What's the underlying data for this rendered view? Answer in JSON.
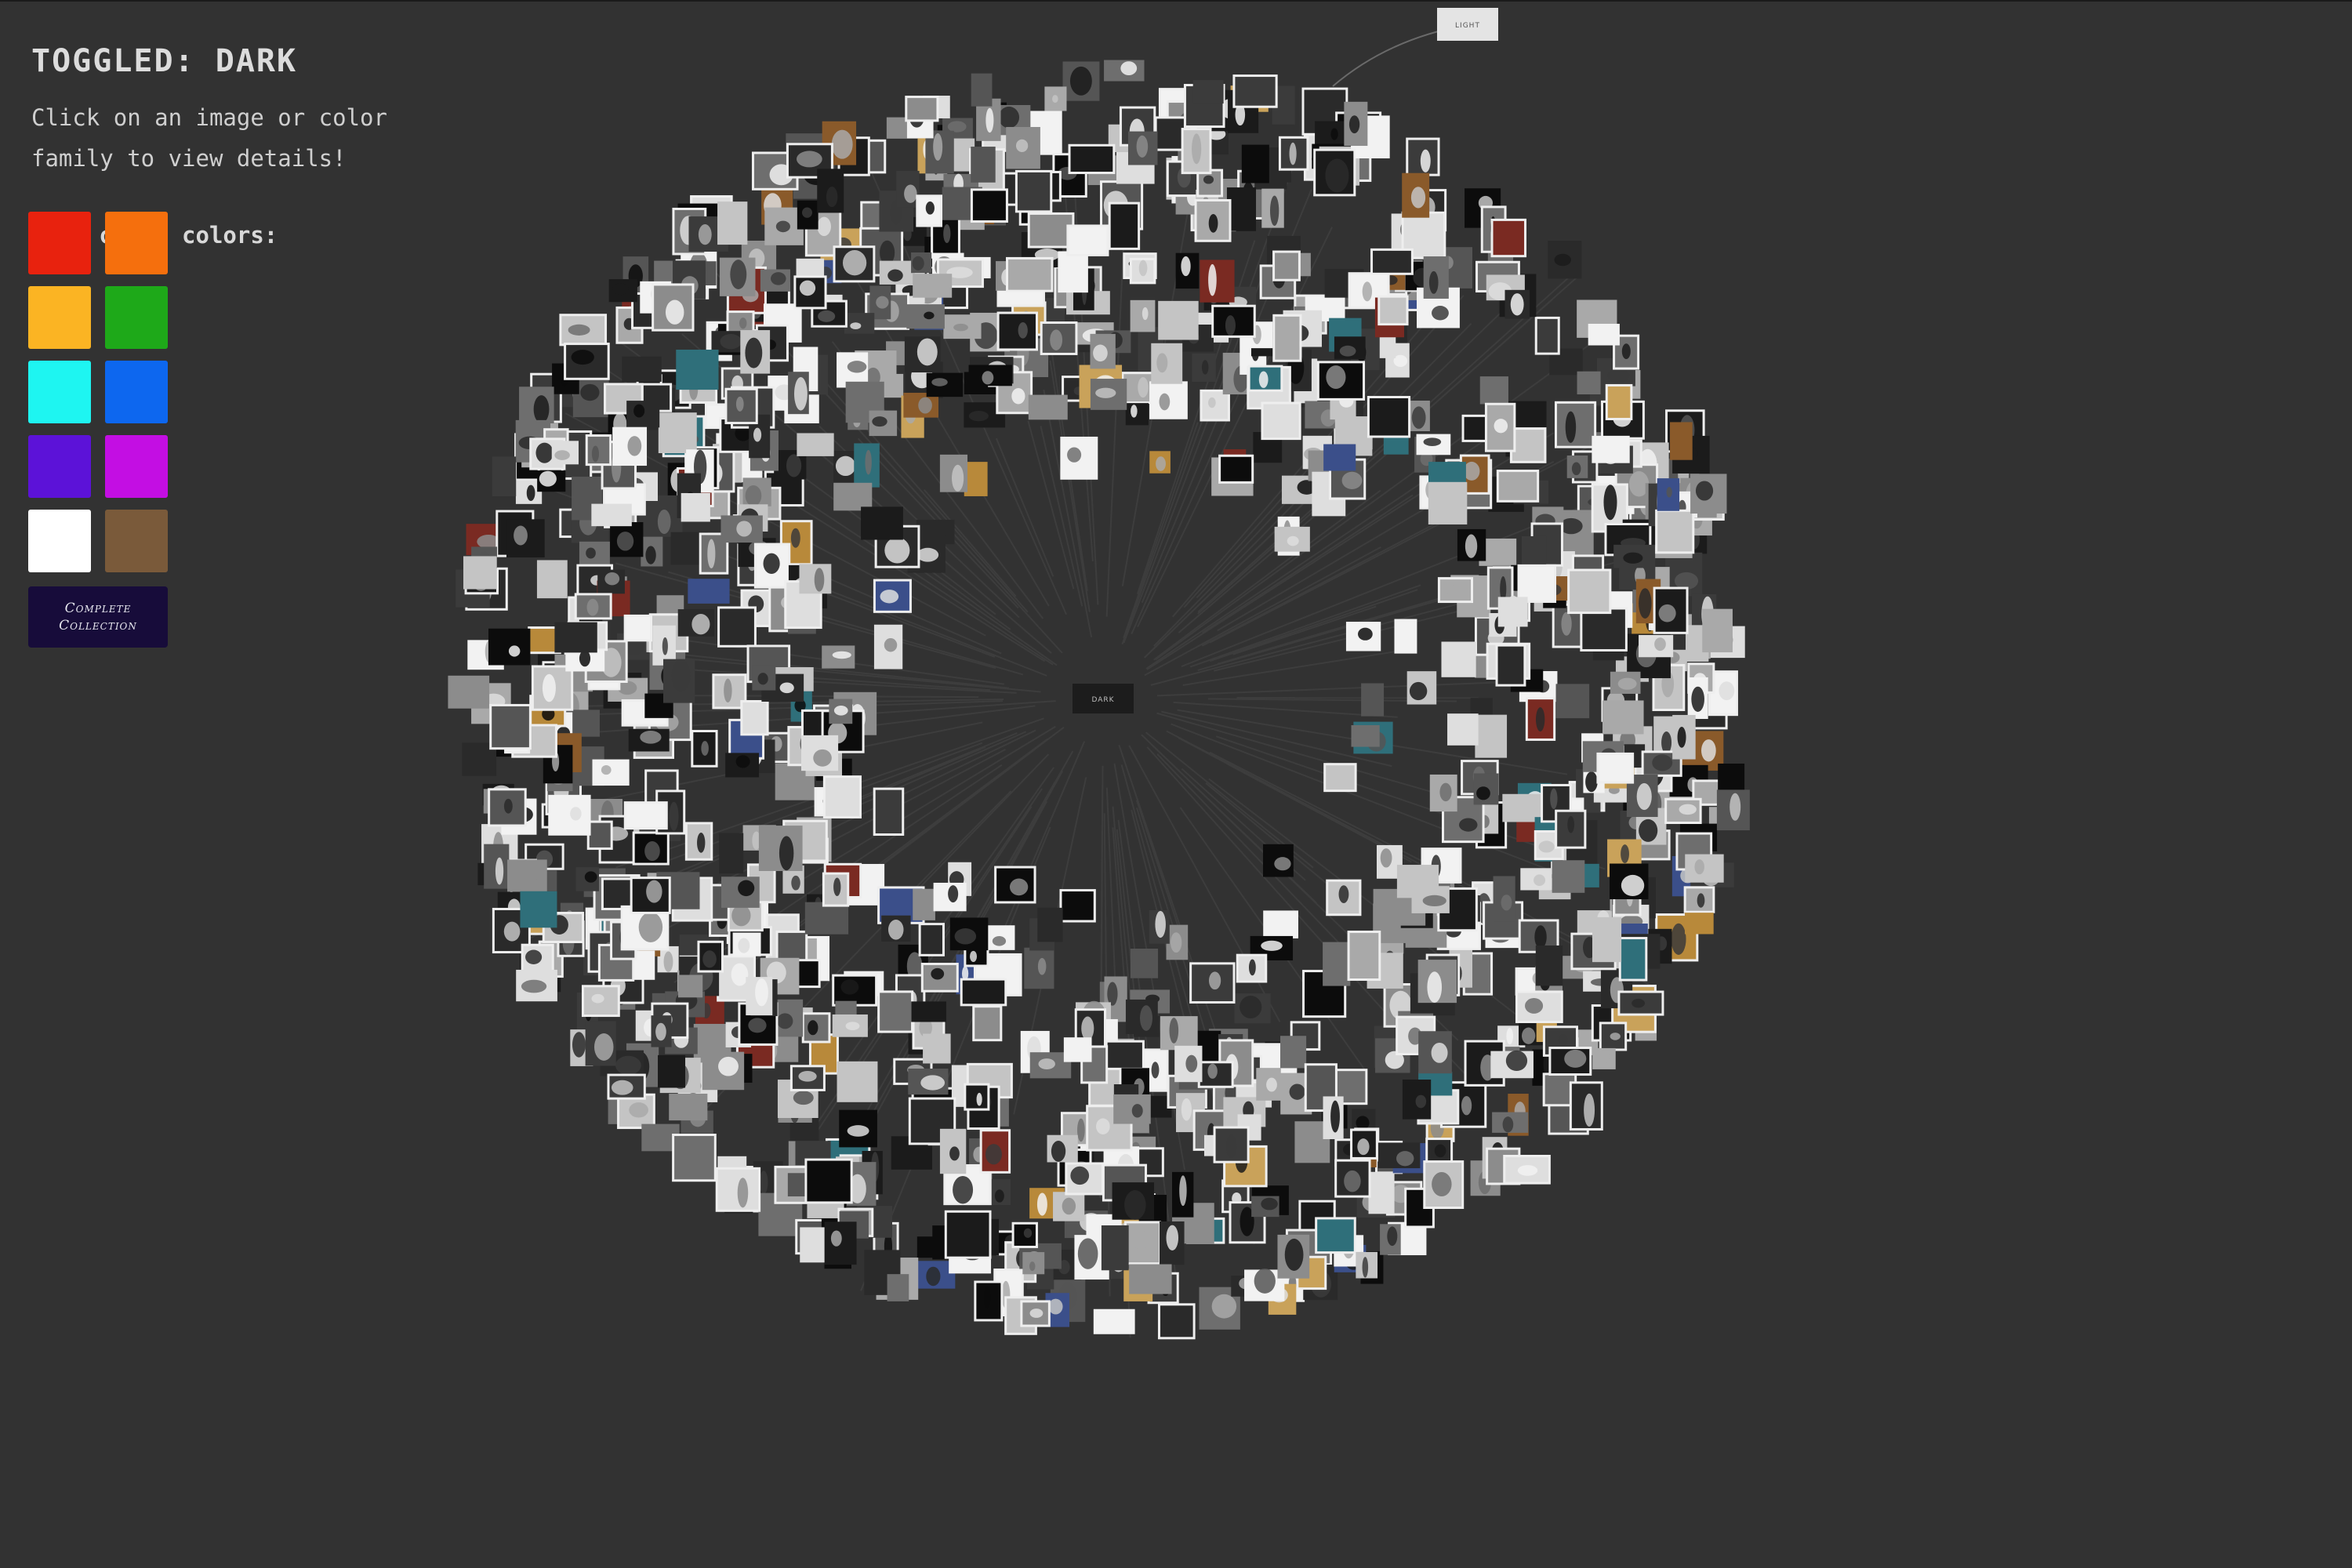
{
  "header": {
    "title": "TOGGLED: DARK",
    "instructions": "Click on an image or color family to view details!"
  },
  "color_panel": {
    "label": "View other colors:",
    "swatches": [
      {
        "name": "red",
        "color": "#e8220e"
      },
      {
        "name": "orange",
        "color": "#f56f0d"
      },
      {
        "name": "yellow",
        "color": "#fbb423"
      },
      {
        "name": "green",
        "color": "#1ea919"
      },
      {
        "name": "cyan",
        "color": "#1ef5f1"
      },
      {
        "name": "blue",
        "color": "#0d67ef"
      },
      {
        "name": "purple",
        "color": "#5c12d8"
      },
      {
        "name": "magenta",
        "color": "#c30ee3"
      },
      {
        "name": "white",
        "color": "#ffffff"
      },
      {
        "name": "brown",
        "color": "#7a5a3a"
      }
    ],
    "complete_button": "Complete Collection"
  },
  "visualization": {
    "center_node": "DARK",
    "linked_node": "LIGHT",
    "thumbnail_tones": [
      "#0c0c0c",
      "#1b1b1b",
      "#2a2a2a",
      "#3b3b3b",
      "#555555",
      "#6e6e6e",
      "#8c8c8c",
      "#a9a9a9",
      "#c4c4c4",
      "#dedede",
      "#f2f2f2"
    ],
    "accent_tones": [
      "#b8893a",
      "#8a5a2a",
      "#2f6f7a",
      "#7a2a22",
      "#c9a25a",
      "#3b4f8a"
    ]
  }
}
